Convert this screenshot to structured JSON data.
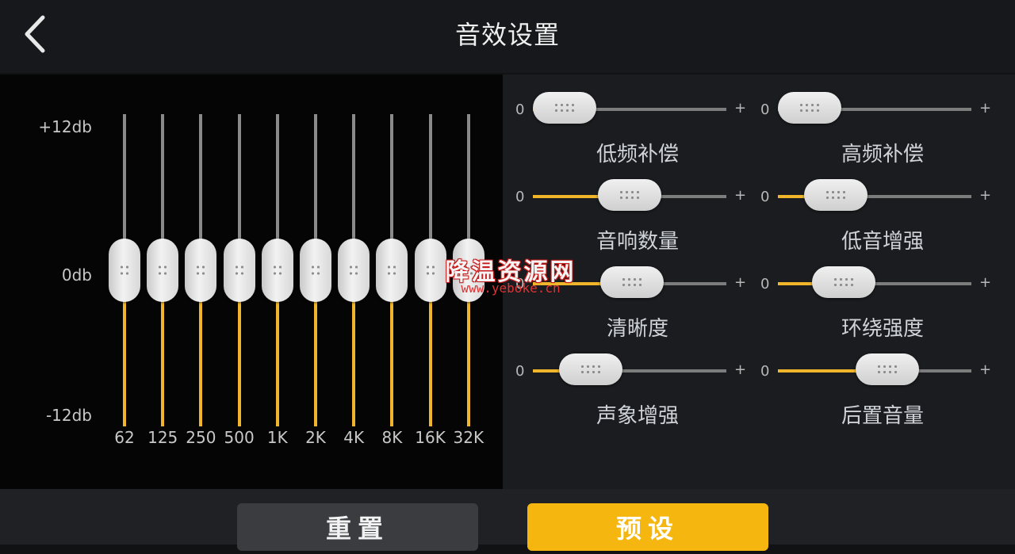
{
  "header": {
    "title": "音效设置"
  },
  "equalizer": {
    "db_labels": {
      "top": "+12db",
      "middle": "0db",
      "bottom": "-12db"
    },
    "range_db": [
      -12,
      12
    ],
    "bands": [
      {
        "freq": "62",
        "gain_db": 0
      },
      {
        "freq": "125",
        "gain_db": 0
      },
      {
        "freq": "250",
        "gain_db": 0
      },
      {
        "freq": "500",
        "gain_db": 0
      },
      {
        "freq": "1K",
        "gain_db": 0
      },
      {
        "freq": "2K",
        "gain_db": 0
      },
      {
        "freq": "4K",
        "gain_db": 0
      },
      {
        "freq": "8K",
        "gain_db": 0
      },
      {
        "freq": "16K",
        "gain_db": 0
      },
      {
        "freq": "32K",
        "gain_db": 0
      }
    ]
  },
  "effects": {
    "min_label": "0",
    "max_label": "+",
    "items": [
      {
        "label": "低频补偿",
        "value": 0.0
      },
      {
        "label": "高频补偿",
        "value": 0.0
      },
      {
        "label": "音响数量",
        "value": 0.5
      },
      {
        "label": "低音增强",
        "value": 0.2
      },
      {
        "label": "清晰度",
        "value": 0.52
      },
      {
        "label": "环绕强度",
        "value": 0.26
      },
      {
        "label": "声象增强",
        "value": 0.2
      },
      {
        "label": "后置音量",
        "value": 0.6
      }
    ]
  },
  "buttons": {
    "reset": "重置",
    "preset": "预设"
  },
  "watermark": {
    "main": "降温资源网",
    "sub": "www.yeboke.cn"
  },
  "colors": {
    "accent": "#f0b52b",
    "preset_button": "#f5b70f"
  }
}
